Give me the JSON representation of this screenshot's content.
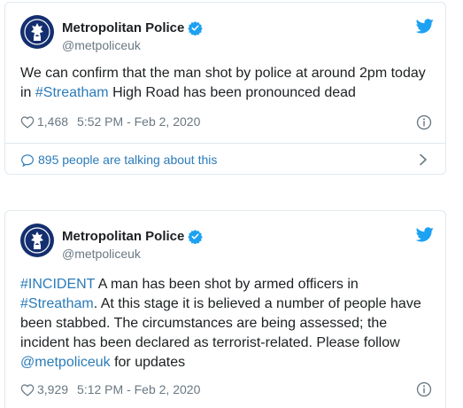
{
  "tweets": [
    {
      "author_name": "Metropolitan Police",
      "author_handle": "@metpoliceuk",
      "text_parts": [
        "We can confirm that the man shot by police at around 2pm today in ",
        "#Streatham",
        " High Road has been pronounced dead"
      ],
      "likes": "1,468",
      "timestamp": "5:52 PM - Feb 2, 2020",
      "talking": "895 people are talking about this"
    },
    {
      "author_name": "Metropolitan Police",
      "author_handle": "@metpoliceuk",
      "text_parts": [
        "#INCIDENT",
        " A man has been shot by armed officers in ",
        "#Streatham",
        ". At this stage it is believed a number of people have been stabbed. The circumstances are being assessed; the incident has been declared as terrorist-related. Please follow ",
        "@metpoliceuk",
        " for updates"
      ],
      "likes": "3,929",
      "timestamp": "5:12 PM - Feb 2, 2020"
    }
  ],
  "icons": {
    "avatar": "met-police-crest-icon",
    "verified": "verified-badge-icon",
    "brand": "twitter-bird-icon",
    "like": "heart-icon",
    "info": "info-icon",
    "conversation": "chat-bubble-icon",
    "chevron": "chevron-right-icon"
  },
  "colors": {
    "link": "#2b7bb9",
    "brand": "#1da1f2",
    "muted": "#697882",
    "text": "#1c2022",
    "border": "#e1e8ed",
    "avatar_bg": "#142f6f"
  }
}
